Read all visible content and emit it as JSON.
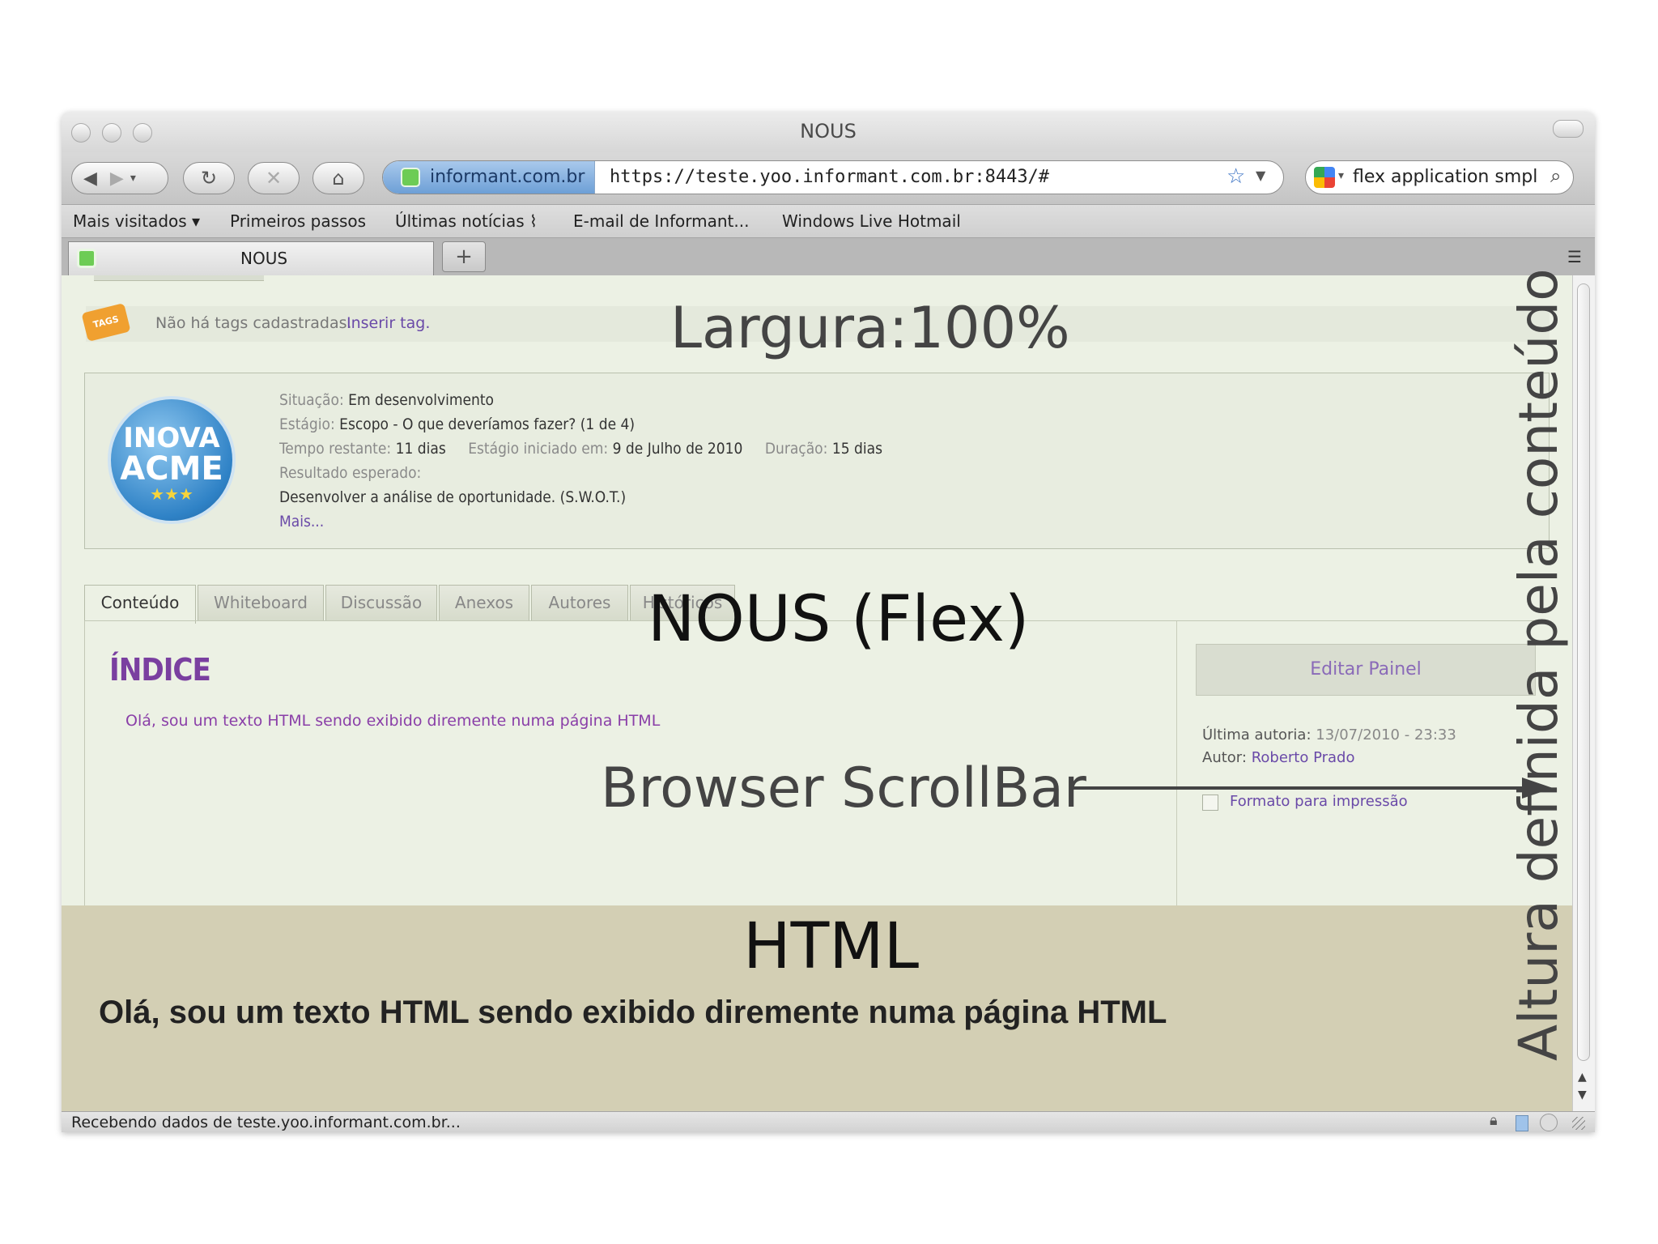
{
  "window": {
    "title": "NOUS"
  },
  "toolbar": {
    "identity_domain": "informant.com.br",
    "url": "https://teste.yoo.informant.com.br:8443/#",
    "search_text": "flex application smpl"
  },
  "bookmarks": [
    "Mais visitados ▾",
    "Primeiros passos",
    "Últimas notícias ⌇",
    "E-mail de Informant...",
    "Windows Live Hotmail"
  ],
  "tab": {
    "title": "NOUS",
    "new_tab": "+"
  },
  "app": {
    "tags_text": "Não há tags cadastradas.",
    "tags_link": "Inserir tag.",
    "tags_badge": "TAGS",
    "logo_line1": "INOVA",
    "logo_line2": "ACME",
    "logo_stars": "★★★",
    "situacao_label": "Situação:",
    "situacao_value": "Em desenvolvimento",
    "estagio_label": "Estágio:",
    "estagio_value": "Escopo - O que deveríamos fazer? (1 de 4)",
    "tempo_label": "Tempo restante:",
    "tempo_value": "11 dias",
    "iniciado_label": "Estágio iniciado em:",
    "iniciado_value": "9 de Julho de 2010",
    "duracao_label": "Duração:",
    "duracao_value": "15 dias",
    "resultado_label": "Resultado esperado:",
    "resultado_value": "Desenvolver a análise de oportunidade. (S.W.O.T.)",
    "mais_link": "Mais...",
    "tabs": [
      "Conteúdo",
      "Whiteboard",
      "Discussão",
      "Anexos",
      "Autores",
      "Históricos"
    ],
    "indice_title": "ÍNDICE",
    "indice_text": "Olá, sou um texto HTML sendo exibido diremente numa página HTML",
    "editar_button": "Editar Painel",
    "ultima_label": "Última autoria:",
    "ultima_value": "13/07/2010 - 23:33",
    "autor_label": "Autor:",
    "autor_value": "Roberto Prado",
    "formato_label": "Formato para impressão"
  },
  "html_section": {
    "text": "Olá, sou um texto HTML sendo exibido diremente numa página HTML"
  },
  "status": {
    "text": "Recebendo dados de teste.yoo.informant.com.br..."
  },
  "annotations": {
    "largura": "Largura:100%",
    "nous_flex": "NOUS (Flex)",
    "browser_scrollbar": "Browser ScrollBar",
    "html": "HTML",
    "altura": "Altura definida pela conteúdo"
  }
}
